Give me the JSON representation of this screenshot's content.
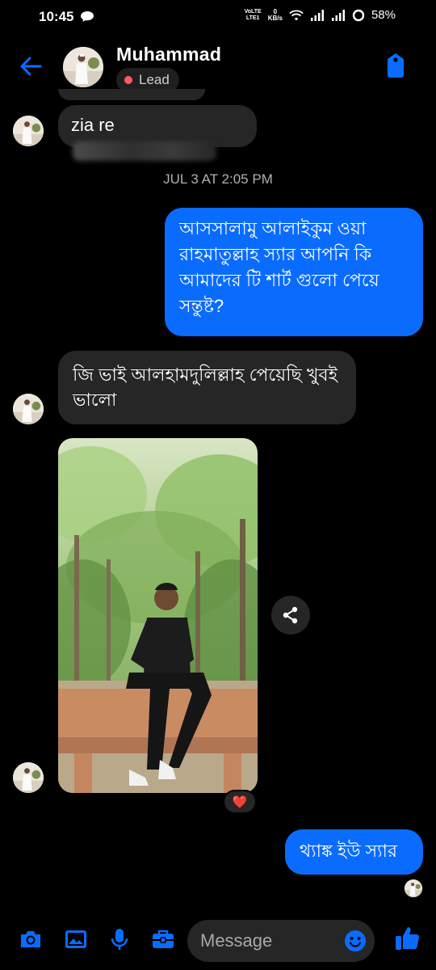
{
  "status_bar": {
    "time": "10:45",
    "volte_top": "VoLTE",
    "volte_bottom": "LTE1",
    "speed_value": "0",
    "speed_unit": "KB/s",
    "battery": "58%"
  },
  "header": {
    "contact_name": "Muhammad",
    "label": "Lead",
    "label_color": "#ff5a5f"
  },
  "messages": {
    "prev_incoming": "zia re",
    "timestamp": "JUL 3 AT 2:05 PM",
    "outgoing_1": "আসসালামু আলাইকুম ওয়া রাহমাতুল্লাহ স্যার আপনি কি আমাদের টি শার্ট গুলো পেয়ে সন্তুষ্ট?",
    "incoming_1": "জি ভাই আলহামদুলিল্লাহ পেয়েছি খুবই ভালো",
    "reaction": "❤️",
    "outgoing_2": "থ্যাঙ্ক ইউ স্যার"
  },
  "composer": {
    "placeholder": "Message"
  },
  "colors": {
    "accent": "#0a6cff",
    "incoming_bubble": "#262626",
    "background": "#000000"
  },
  "icons": [
    "back-arrow-icon",
    "tag-icon",
    "camera-icon",
    "image-icon",
    "microphone-icon",
    "briefcase-icon",
    "emoji-icon",
    "thumbs-up-icon",
    "share-icon"
  ]
}
